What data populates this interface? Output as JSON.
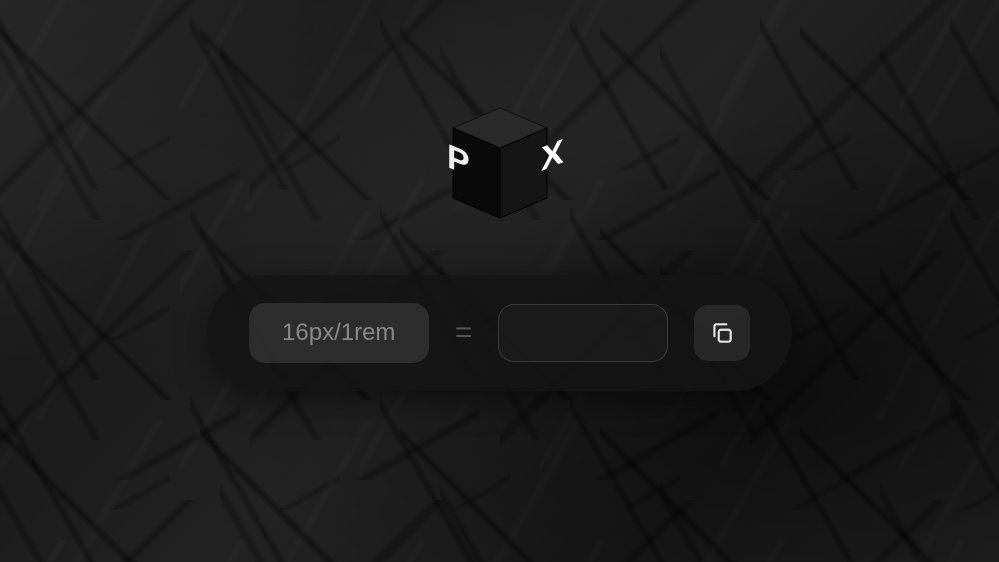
{
  "logo": {
    "text_left": "P",
    "text_right": "X"
  },
  "converter": {
    "input_placeholder": "16px/1rem",
    "input_value": "",
    "equals_symbol": "=",
    "output_value": "",
    "copy_icon": "copy-icon"
  }
}
